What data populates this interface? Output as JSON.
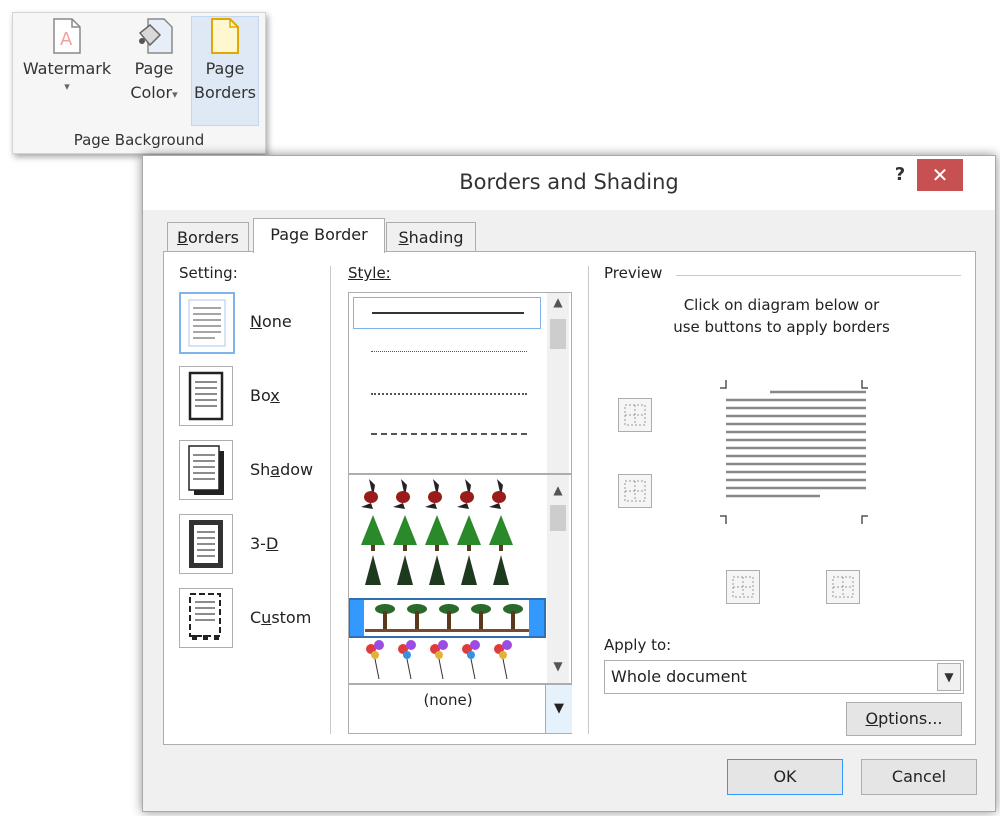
{
  "ribbon": {
    "watermark": {
      "label": "Watermark",
      "caret": "▾"
    },
    "page_color": {
      "line1": "Page",
      "line2": "Color",
      "caret": "▾"
    },
    "page_borders": {
      "line1": "Page",
      "line2": "Borders"
    },
    "group_label": "Page Background"
  },
  "dialog": {
    "title": "Borders and Shading",
    "help": "?",
    "close": "✕",
    "tabs": {
      "borders": {
        "label_pre": "",
        "label_key": "B",
        "label_post": "orders"
      },
      "page_border": {
        "label": "Page Border"
      },
      "shading": {
        "label_pre": "",
        "label_key": "S",
        "label_post": "hading"
      }
    },
    "setting": {
      "label": "Setting:",
      "none": {
        "key": "N",
        "rest": "one"
      },
      "box": {
        "pre": "Bo",
        "key": "x",
        "rest": ""
      },
      "shadow": {
        "pre": "Sh",
        "key": "a",
        "rest": "dow"
      },
      "three_d": {
        "pre": "3-",
        "key": "D",
        "rest": ""
      },
      "custom": {
        "pre": "C",
        "key": "u",
        "rest": "stom"
      }
    },
    "style": {
      "label": "Style:"
    },
    "art": {
      "value": "(none)"
    },
    "preview": {
      "label": "Preview",
      "instruction_line1": "Click on diagram below or",
      "instruction_line2": "use buttons to apply borders"
    },
    "apply_to": {
      "label": "Apply to:",
      "value": "Whole document"
    },
    "buttons": {
      "options": {
        "key": "O",
        "rest": "ptions..."
      },
      "ok": "OK",
      "cancel": "Cancel"
    }
  },
  "colors": {
    "selection": "#3399ff",
    "close": "#c75050",
    "accent": "#7eb4ea"
  }
}
